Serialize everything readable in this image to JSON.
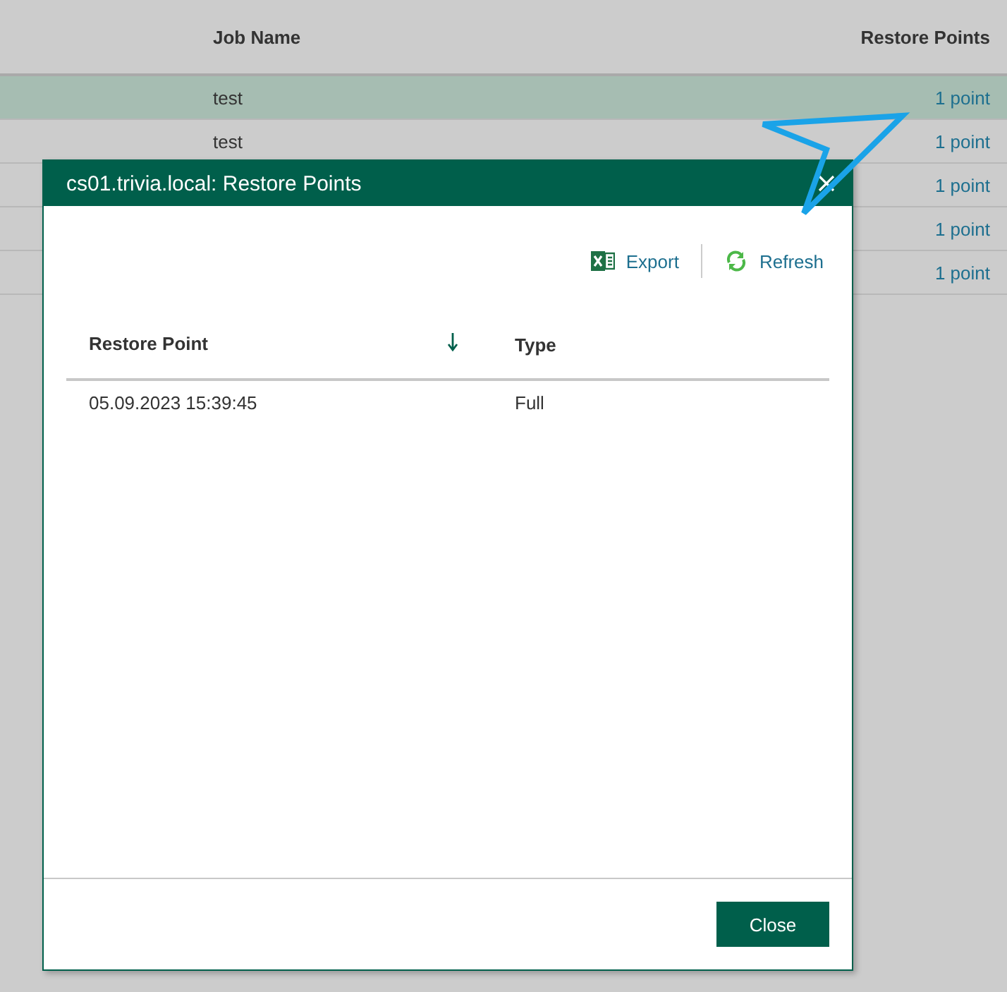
{
  "background_table": {
    "columns": [
      "Job Name",
      "Restore Points"
    ],
    "rows": [
      {
        "job_name": "test",
        "restore_points": "1 point",
        "selected": true
      },
      {
        "job_name": "test",
        "restore_points": "1 point",
        "selected": false
      },
      {
        "restore_points": "1 point",
        "selected": false
      },
      {
        "restore_points": "1 point",
        "selected": false
      },
      {
        "restore_points": "1 point",
        "selected": false
      }
    ]
  },
  "dialog": {
    "title": "cs01.trivia.local: Restore Points",
    "toolbar": [
      {
        "kind": "export",
        "label": "Export"
      },
      {
        "kind": "refresh",
        "label": "Refresh"
      }
    ],
    "table": {
      "columns": [
        {
          "label": "Restore Point",
          "sorted": true
        },
        {
          "label": "Type",
          "sorted": false
        }
      ],
      "rows": [
        [
          "05.09.2023 15:39:45",
          "Full"
        ]
      ]
    },
    "buttons": [
      "Close"
    ]
  }
}
